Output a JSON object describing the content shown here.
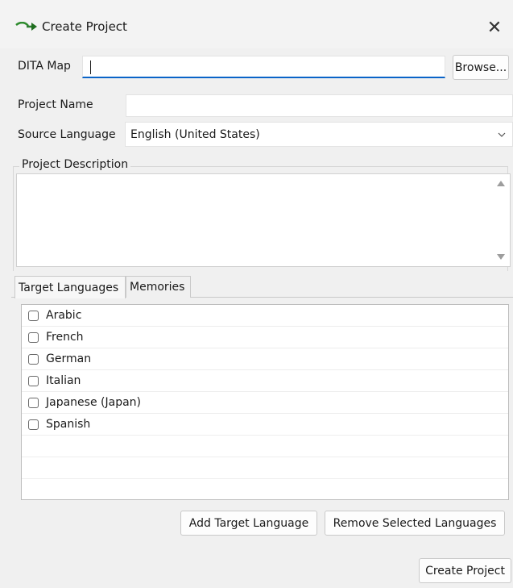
{
  "window": {
    "title": "Create Project",
    "close_symbol": "✕",
    "icon": "arrow-icon"
  },
  "form": {
    "dita_map_label": "DITA Map",
    "dita_map_value": "",
    "browse_label": "Browse...",
    "project_name_label": "Project Name",
    "project_name_value": "",
    "source_language_label": "Source Language",
    "source_language_value": "English (United States)",
    "description_label": "Project Description",
    "description_value": ""
  },
  "tabs": [
    {
      "label": "Target Languages",
      "active": true
    },
    {
      "label": "Memories",
      "active": false
    }
  ],
  "languages": [
    {
      "name": "Arabic",
      "checked": false
    },
    {
      "name": "French",
      "checked": false
    },
    {
      "name": "German",
      "checked": false
    },
    {
      "name": "Italian",
      "checked": false
    },
    {
      "name": "Japanese (Japan)",
      "checked": false
    },
    {
      "name": "Spanish",
      "checked": false
    }
  ],
  "buttons": {
    "add_target_language": "Add Target Language",
    "remove_selected_languages": "Remove Selected Languages",
    "create_project": "Create Project"
  },
  "colors": {
    "focus_underline": "#0a64c8",
    "window_bg": "#f0f0f0"
  }
}
